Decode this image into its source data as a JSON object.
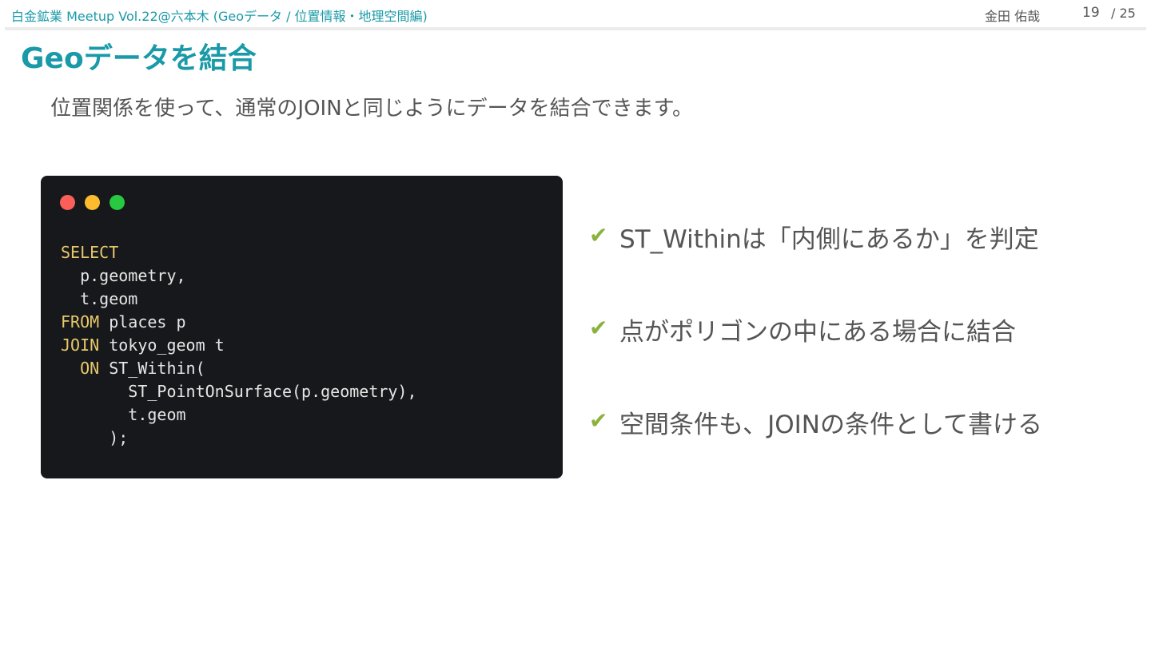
{
  "header": {
    "event_title": "白金鉱業 Meetup Vol.22@六本木 (Geoデータ / 位置情報・地理空間編)",
    "author": "金田 佑哉",
    "page_current": "19",
    "page_total_text": "/ 25"
  },
  "slide": {
    "title": "Geoデータを結合",
    "lead": "位置関係を使って、通常のJOINと同じようにデータを結合できます。"
  },
  "code": {
    "lines": [
      {
        "kw": "SELECT",
        "rest": ""
      },
      {
        "kw": "",
        "rest": "  p.geometry,"
      },
      {
        "kw": "",
        "rest": "  t.geom"
      },
      {
        "kw": "FROM",
        "rest": " places p"
      },
      {
        "kw": "JOIN",
        "rest": " tokyo_geom t"
      },
      {
        "kw": "  ON",
        "rest": " ST_Within("
      },
      {
        "kw": "",
        "rest": "       ST_PointOnSurface(p.geometry),"
      },
      {
        "kw": "",
        "rest": "       t.geom"
      },
      {
        "kw": "",
        "rest": "     );"
      }
    ],
    "window_buttons": [
      "close-dot",
      "minimize-dot",
      "maximize-dot"
    ],
    "colors": {
      "background": "#16181b",
      "keyword": "#e8c86a",
      "text": "#e6e6e6"
    }
  },
  "bullets": [
    {
      "icon": "check-icon",
      "text": "ST_Withinは「内側にあるか」を判定"
    },
    {
      "icon": "check-icon",
      "text": "点がポリゴンの中にある場合に結合"
    },
    {
      "icon": "check-icon",
      "text": "空間条件も、JOINの条件として書ける"
    }
  ],
  "colors": {
    "accent": "#1a9aa8",
    "check": "#8bb23f",
    "body_text": "#555555"
  }
}
